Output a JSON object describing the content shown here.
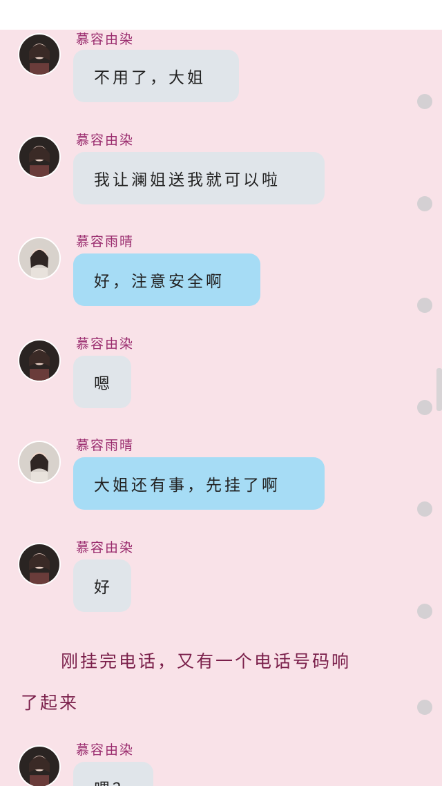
{
  "messages": [
    {
      "sender": "慕容由染",
      "text": "不用了，大姐",
      "style": "gray",
      "avatar": "avatar-ranyou"
    },
    {
      "sender": "慕容由染",
      "text": "我让澜姐送我就可以啦",
      "style": "gray",
      "avatar": "avatar-ranyou"
    },
    {
      "sender": "慕容雨晴",
      "text": "好，注意安全啊",
      "style": "blue",
      "avatar": "avatar-yuqing"
    },
    {
      "sender": "慕容由染",
      "text": "嗯",
      "style": "gray",
      "avatar": "avatar-ranyou"
    },
    {
      "sender": "慕容雨晴",
      "text": "大姐还有事，先挂了啊",
      "style": "blue",
      "avatar": "avatar-yuqing"
    },
    {
      "sender": "慕容由染",
      "text": "好",
      "style": "gray",
      "avatar": "avatar-ranyou"
    }
  ],
  "narration": {
    "line1": "刚挂完电话，又有一个电话号码响",
    "line2": "了起来"
  },
  "last_message": {
    "sender": "慕容由染",
    "text": "喂？",
    "style": "gray",
    "avatar": "avatar-ranyou"
  },
  "colors": {
    "background": "#f9e2e8",
    "gray_bubble": "#e0e5ea",
    "blue_bubble": "#a6dcf5",
    "sender_name": "#9a2c6e",
    "narration": "#7a1f4a"
  }
}
